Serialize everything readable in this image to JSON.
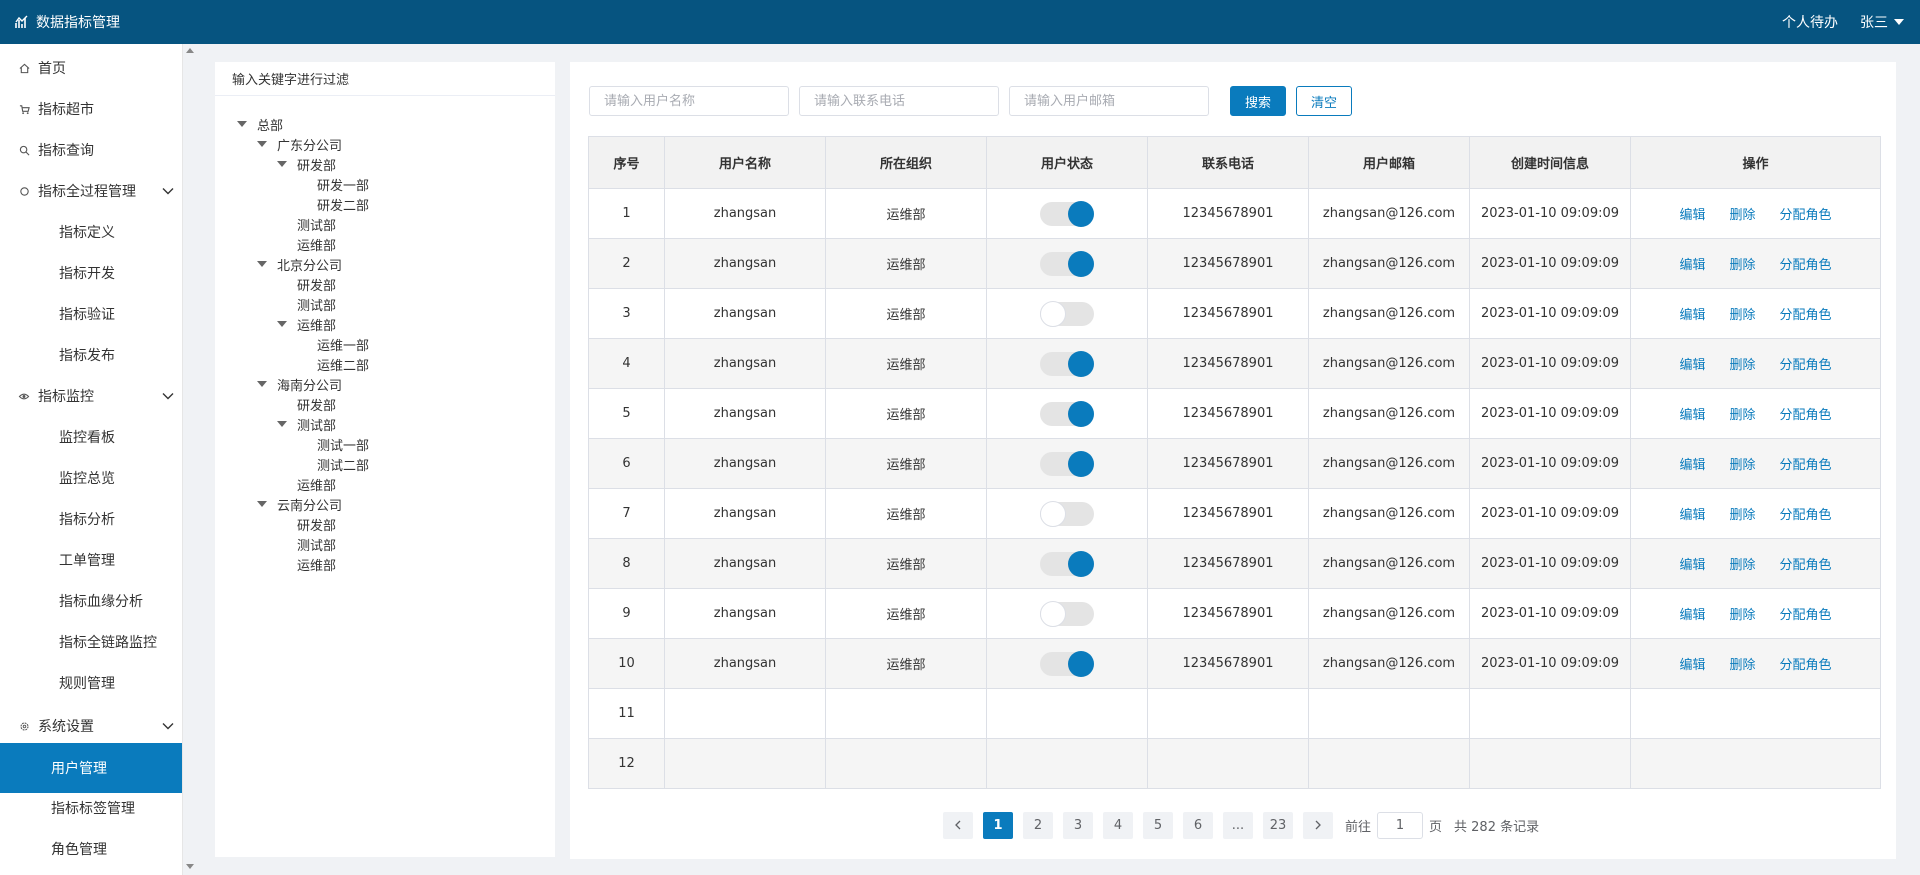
{
  "header": {
    "title": "数据指标管理",
    "todo": "个人待办",
    "user": "张三"
  },
  "sidebar": {
    "items": [
      {
        "label": "首页",
        "icon": "home-icon"
      },
      {
        "label": "指标超市",
        "icon": "cart-icon"
      },
      {
        "label": "指标查询",
        "icon": "search-icon"
      },
      {
        "label": "指标全过程管理",
        "icon": "circle-icon"
      },
      {
        "label": "指标定义"
      },
      {
        "label": "指标开发"
      },
      {
        "label": "指标验证"
      },
      {
        "label": "指标发布"
      },
      {
        "label": "指标监控",
        "icon": "eye-icon"
      },
      {
        "label": "监控看板"
      },
      {
        "label": "监控总览"
      },
      {
        "label": "指标分析"
      },
      {
        "label": "工单管理"
      },
      {
        "label": "指标血缘分析"
      },
      {
        "label": "指标全链路监控"
      },
      {
        "label": "规则管理"
      },
      {
        "label": "系统设置",
        "icon": "gear-icon"
      },
      {
        "label": "用户管理"
      },
      {
        "label": "指标标签管理"
      },
      {
        "label": "角色管理"
      }
    ]
  },
  "tree": {
    "filter_placeholder": "输入关键字进行过滤",
    "nodes": [
      "总部",
      "广东分公司",
      "研发部",
      "研发一部",
      "研发二部",
      "测试部",
      "运维部",
      "北京分公司",
      "研发部",
      "测试部",
      "运维部",
      "运维一部",
      "运维二部",
      "海南分公司",
      "研发部",
      "测试部",
      "测试一部",
      "测试二部",
      "运维部",
      "云南分公司",
      "研发部",
      "测试部",
      "运维部"
    ]
  },
  "search": {
    "username_placeholder": "请输入用户名称",
    "phone_placeholder": "请输入联系电话",
    "email_placeholder": "请输入用户邮箱",
    "search_label": "搜索",
    "clear_label": "清空"
  },
  "table": {
    "headers": [
      "序号",
      "用户名称",
      "所在组织",
      "用户状态",
      "联系电话",
      "用户邮箱",
      "创建时间信息",
      "操作"
    ],
    "actions": [
      "编辑",
      "删除",
      "分配角色"
    ],
    "rows": [
      {
        "no": "1",
        "name": "zhangsan",
        "org": "运维部",
        "status": true,
        "phone": "12345678901",
        "email": "zhangsan@126.com",
        "created": "2023-01-10  09:09:09"
      },
      {
        "no": "2",
        "name": "zhangsan",
        "org": "运维部",
        "status": true,
        "phone": "12345678901",
        "email": "zhangsan@126.com",
        "created": "2023-01-10  09:09:09"
      },
      {
        "no": "3",
        "name": "zhangsan",
        "org": "运维部",
        "status": false,
        "phone": "12345678901",
        "email": "zhangsan@126.com",
        "created": "2023-01-10  09:09:09"
      },
      {
        "no": "4",
        "name": "zhangsan",
        "org": "运维部",
        "status": true,
        "phone": "12345678901",
        "email": "zhangsan@126.com",
        "created": "2023-01-10  09:09:09"
      },
      {
        "no": "5",
        "name": "zhangsan",
        "org": "运维部",
        "status": true,
        "phone": "12345678901",
        "email": "zhangsan@126.com",
        "created": "2023-01-10  09:09:09"
      },
      {
        "no": "6",
        "name": "zhangsan",
        "org": "运维部",
        "status": true,
        "phone": "12345678901",
        "email": "zhangsan@126.com",
        "created": "2023-01-10  09:09:09"
      },
      {
        "no": "7",
        "name": "zhangsan",
        "org": "运维部",
        "status": false,
        "phone": "12345678901",
        "email": "zhangsan@126.com",
        "created": "2023-01-10  09:09:09"
      },
      {
        "no": "8",
        "name": "zhangsan",
        "org": "运维部",
        "status": true,
        "phone": "12345678901",
        "email": "zhangsan@126.com",
        "created": "2023-01-10  09:09:09"
      },
      {
        "no": "9",
        "name": "zhangsan",
        "org": "运维部",
        "status": false,
        "phone": "12345678901",
        "email": "zhangsan@126.com",
        "created": "2023-01-10  09:09:09"
      },
      {
        "no": "10",
        "name": "zhangsan",
        "org": "运维部",
        "status": true,
        "phone": "12345678901",
        "email": "zhangsan@126.com",
        "created": "2023-01-10  09:09:09"
      },
      {
        "no": "11"
      },
      {
        "no": "12"
      }
    ]
  },
  "pager": {
    "pages": [
      "1",
      "2",
      "3",
      "4",
      "5",
      "6",
      "...",
      "23"
    ],
    "current": "1",
    "goto_prefix": "前往",
    "goto_value": "1",
    "goto_suffix": "页",
    "total_text": "共 282 条记录"
  },
  "colors": {
    "header_bg": "#065480",
    "accent": "#0a7bbd"
  }
}
